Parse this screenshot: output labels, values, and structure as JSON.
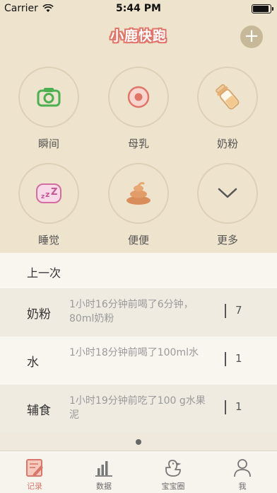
{
  "status_bar": {
    "carrier": "Carrier",
    "time": "5:44 PM",
    "battery_level": 0.95
  },
  "nav": {
    "title": "小鹿快跑",
    "add_icon": "plus-icon",
    "add_symbol": "+"
  },
  "actions": [
    {
      "label": "瞬间",
      "icon": "camera-icon"
    },
    {
      "label": "母乳",
      "icon": "breastfeeding-dot-icon"
    },
    {
      "label": "奶粉",
      "icon": "baby-bottle-icon"
    },
    {
      "label": "睡觉",
      "icon": "sleep-zzz-icon"
    },
    {
      "label": "便便",
      "icon": "poop-icon"
    },
    {
      "label": "更多",
      "icon": "chevron-down-icon"
    }
  ],
  "last_section": {
    "title": "上一次",
    "rows": [
      {
        "name": "奶粉",
        "desc": "1小时16分钟前喝了6分钟，80ml奶粉",
        "count": "7"
      },
      {
        "name": "水",
        "desc": "1小时18分钟前喝了100ml水",
        "count": "1"
      },
      {
        "name": "辅食",
        "desc": "1小时19分钟前吃了100 g水果泥",
        "count": "1"
      }
    ]
  },
  "tabbar": [
    {
      "label": "记录",
      "icon": "record-notebook-icon",
      "active": true
    },
    {
      "label": "数据",
      "icon": "bar-chart-icon",
      "active": false
    },
    {
      "label": "宝宝圈",
      "icon": "duck-icon",
      "active": false
    },
    {
      "label": "我",
      "icon": "person-icon",
      "active": false
    }
  ],
  "colors": {
    "accent": "#e0766a",
    "top_bg": "#eee3cc",
    "green": "#5cb85c"
  }
}
